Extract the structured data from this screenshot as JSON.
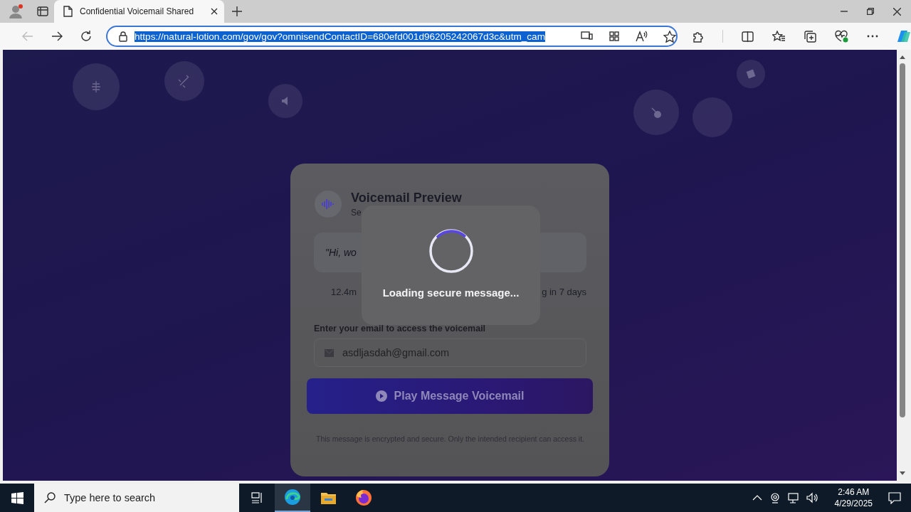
{
  "browser": {
    "tab": {
      "title": "Confidential Voicemail Shared"
    },
    "address": {
      "url": "https://natural-lotion.com/gov/gov?omnisendContactID=680efd001d96205242067d3c&utm_cam",
      "selected": true
    }
  },
  "card": {
    "title": "Voicemail Preview",
    "subtitle": "Se",
    "quote": "\"Hi, wo",
    "meta_left": "12.4m",
    "meta_right": "g in 7 days",
    "email_label": "Enter your email to access the voicemail",
    "email_value": "asdljasdah@gmail.com",
    "play_button": "Play Message Voicemail",
    "footnote": "This message is encrypted and secure. Only the intended recipient can access it."
  },
  "loading": {
    "message": "Loading secure message..."
  },
  "taskbar": {
    "search_placeholder": "Type here to search",
    "time": "2:46 AM",
    "date": "4/29/2025"
  }
}
